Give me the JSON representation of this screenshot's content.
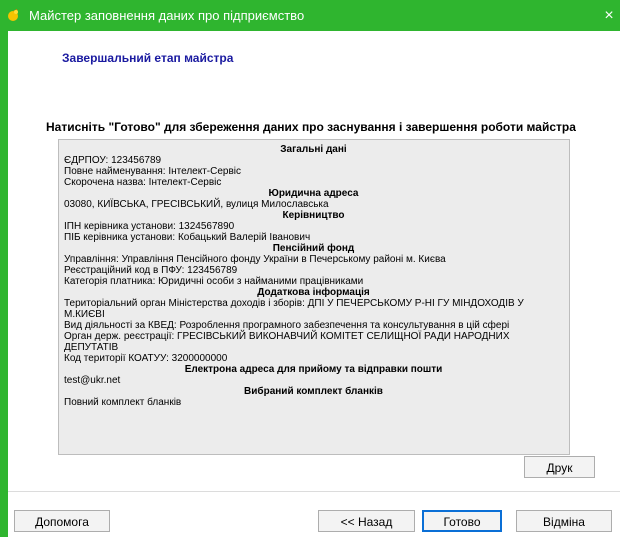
{
  "window": {
    "title": "Майстер заповнення даних про підприємство",
    "close_glyph": "×",
    "accent": "#2fb52f"
  },
  "stage": {
    "title": "Завершальний етап майстра"
  },
  "instruction": "Натисніть \"Готово\" для збереження даних про заснування і завершення роботи майстра",
  "summary": {
    "general": {
      "heading": "Загальні дані",
      "edrpou": "ЄДРПОУ: 123456789",
      "full_name": "Повне найменування: Інтелект-Сервіс",
      "short_name": "Скорочена назва: Інтелект-Сервіс"
    },
    "legal_address": {
      "heading": "Юридична адреса",
      "address": "03080, КИЇВСЬКА, ГРЕСІВСЬКИЙ, вулиця Милославська"
    },
    "management": {
      "heading": "Керівництво",
      "ipn": "ІПН керівника установи: 1324567890",
      "pib": "ПІБ керівника установи: Кобацький Валерій Іванович"
    },
    "pension": {
      "heading": "Пенсійний фонд",
      "department": "Управління: Управління  Пенсійного фонду України  в  Печерському районі м. Києва",
      "reg_code": "Реєстраційний код в ПФУ: 123456789",
      "payer_category": "Категорія платника: Юридичні особи з найманими працівниками"
    },
    "additional": {
      "heading": "Додаткова інформація",
      "tax_authority": "Територіальний орган Міністерства доходів і зборів: ДПІ У ПЕЧЕРСЬКОМУ Р-НІ ГУ МІНДОХОДІВ У М.КИЄВІ",
      "kved": "Вид діяльності за КВЕД: Розроблення програмного забезпечення та консультування в цій сфері",
      "registration_authority": "Орган держ. реєстрації: ГРЕСІВСЬКИЙ ВИКОНАВЧИЙ КОМІТЕТ СЕЛИЩНОЇ РАДИ НАРОДНИХ ДЕПУТАТІВ",
      "koatuu": "Код території КОАТУУ: 3200000000"
    },
    "email": {
      "heading": "Електрона адреса для прийому та відправки пошти",
      "value": "test@ukr.net"
    },
    "forms": {
      "heading": "Вибраний комплект бланків",
      "value": "Повний комплект бланків"
    }
  },
  "buttons": {
    "print": "Друк",
    "help": "Допомога",
    "back": "<< Назад",
    "finish": "Готово",
    "cancel": "Відміна"
  }
}
